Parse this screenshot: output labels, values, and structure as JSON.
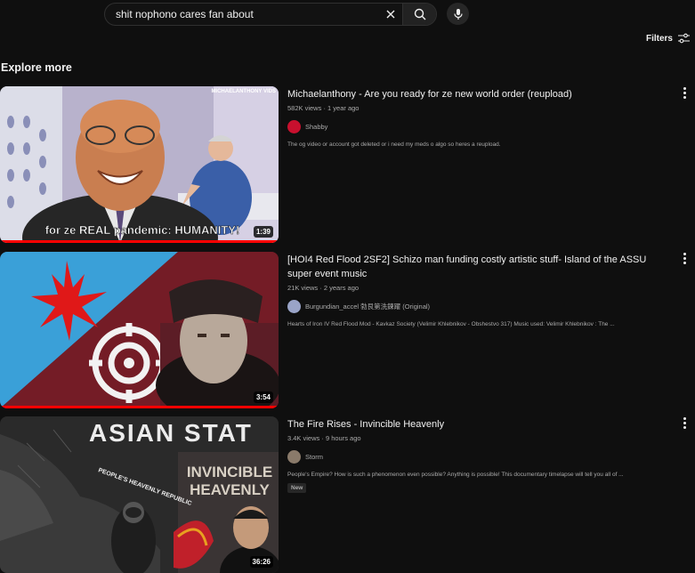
{
  "search": {
    "query": "shit nophono cares fan about",
    "placeholder": "Search"
  },
  "filters": {
    "label": "Filters"
  },
  "section": {
    "title": "Explore more"
  },
  "results": [
    {
      "title": "Michaelanthony - Are you ready for ze new world order (reupload)",
      "views": "582K views",
      "age": "1 year ago",
      "channel": "Shabby",
      "description": "The og video or account got deleted or i need my meds o algo so heres a reupload.",
      "duration": "1:39",
      "thumb_caption": "for ze REAL pandemic: HUMANITY!",
      "thumb_watermark": "MICHAELANTHONY VIDS",
      "avatar_color": "#c8102e"
    },
    {
      "title": "[HOI4 Red Flood 2SF2] Schizo man funding costly artistic stuff- Island of the ASSU super event music",
      "views": "21K views",
      "age": "2 years ago",
      "channel": "Burgundian_accel 勃艮第洗鍊躍 (Original)",
      "description": "Hearts of Iron IV Red Flood Mod - Kavkaz Society (Velimir Khlebnikov - Obshestvo 317) Music used: Velimir Khlebnikov : The ...",
      "duration": "3:54",
      "avatar_color": "#9aa4c8"
    },
    {
      "title": "The Fire Rises - Invincible Heavenly",
      "views": "3.4K views",
      "age": "9 hours ago",
      "channel": "Storm",
      "description": "People's Empire? How is such a phenomenon even possible? Anything is possible! This documentary timelapse will tell you all of ...",
      "badge": "New",
      "duration": "36:26",
      "thumb_text_top": "ASIAN STAT",
      "thumb_text_mid1": "INVINCIBLE",
      "thumb_text_mid2": "HEAVENLY",
      "thumb_map_label": "PEOPLE'S HEAVENLY REPUBLIC",
      "avatar_color": "#8a7a6a"
    }
  ],
  "colors": {
    "background": "#0f0f0f",
    "progress": "#ff0000",
    "text": "#f1f1f1",
    "muted": "#aaaaaa"
  }
}
